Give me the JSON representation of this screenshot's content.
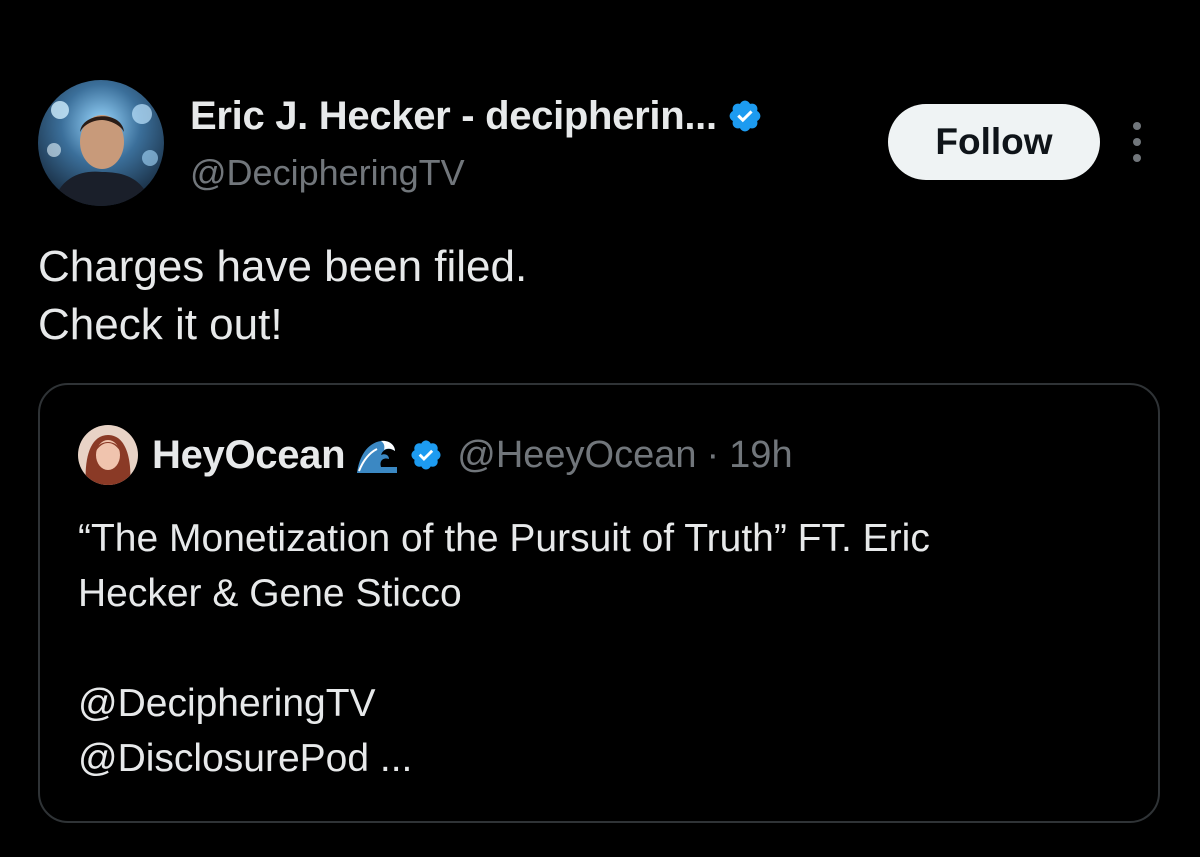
{
  "post": {
    "author": {
      "display_name": "Eric J. Hecker - decipherin...",
      "handle": "@DecipheringTV",
      "verified_badge_icon": "verified-check-icon",
      "verified_color": "#1d9bf0"
    },
    "follow_label": "Follow",
    "more_icon": "more-vertical-icon",
    "text_lines": [
      "Charges have been filed.",
      "Check it out!"
    ]
  },
  "quote": {
    "author": {
      "display_name": "HeyOcean",
      "emoji_icon": "wave-icon",
      "handle": "@HeeyOcean",
      "separator": "·",
      "time": "19h"
    },
    "text_lines": [
      "“The Monetization of the Pursuit of Truth” FT. Eric",
      "Hecker & Gene Sticco",
      "",
      "@DecipheringTV",
      "@DisclosurePod ..."
    ]
  },
  "colors": {
    "background": "#000000",
    "primary_text": "#e7e9ea",
    "secondary_text": "#71767b",
    "border": "#2f3336",
    "follow_bg": "#eff3f4"
  }
}
